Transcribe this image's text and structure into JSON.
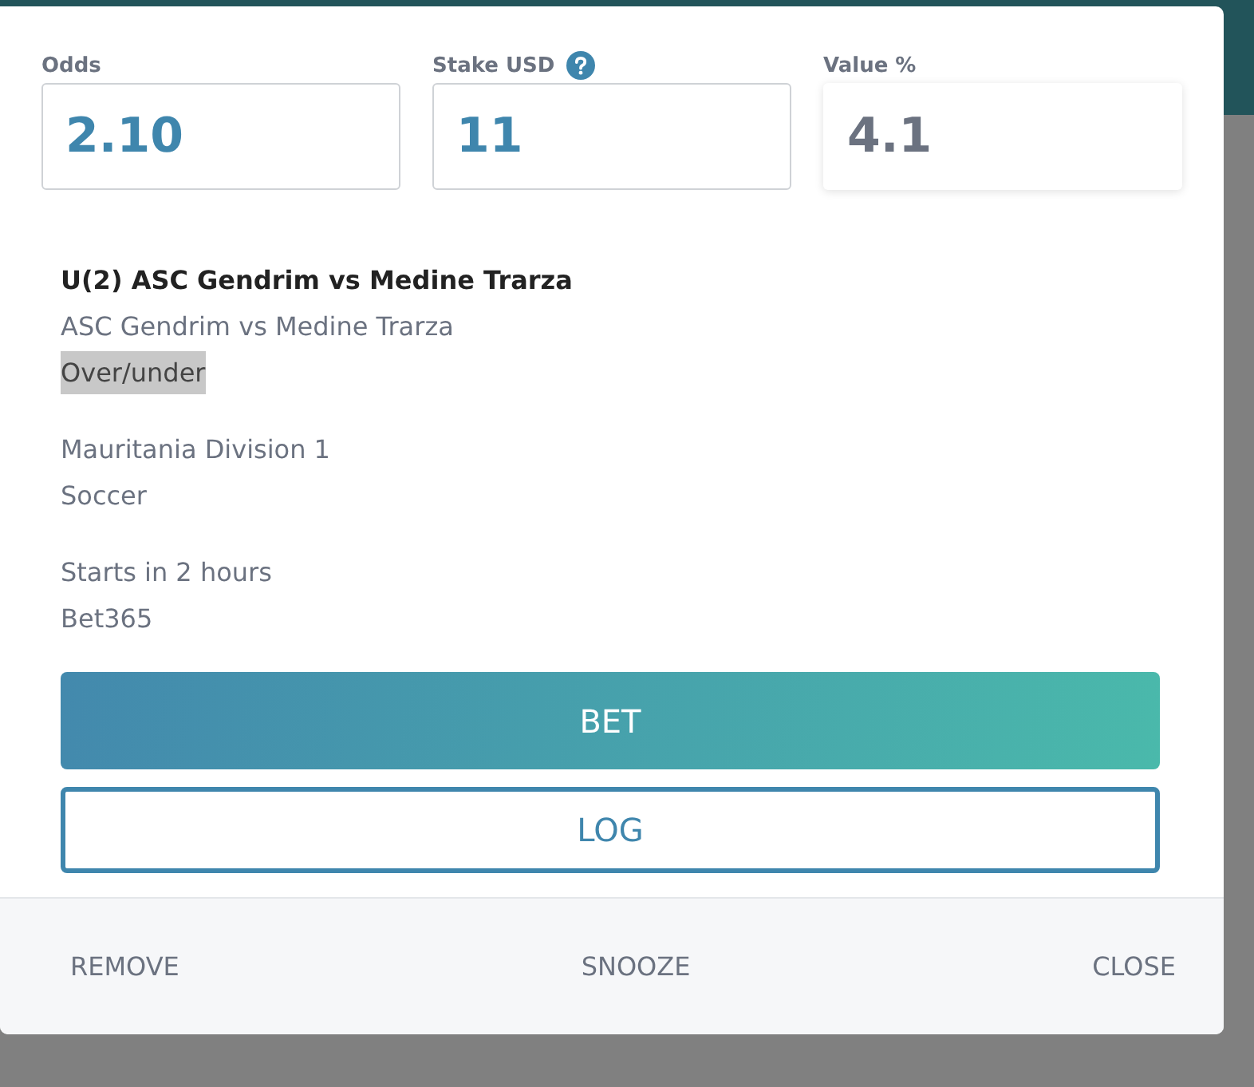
{
  "fields": [
    {
      "label": "Odds",
      "value": "2.10",
      "help": false,
      "readonly": false
    },
    {
      "label": "Stake USD",
      "value": "11",
      "help": true,
      "readonly": false
    },
    {
      "label": "Value %",
      "value": "4.1",
      "help": false,
      "readonly": true
    }
  ],
  "title": "U(2) ASC Gendrim vs Medine Trarza",
  "detail_groups": [
    [
      {
        "text": "ASC Gendrim vs Medine Trarza",
        "highlighted": false
      },
      {
        "text": "Over/under",
        "highlighted": true
      }
    ],
    [
      {
        "text": "Mauritania Division 1",
        "highlighted": false
      },
      {
        "text": "Soccer",
        "highlighted": false
      }
    ],
    [
      {
        "text": "Starts in 2 hours",
        "highlighted": false
      },
      {
        "text": "Bet365",
        "highlighted": false
      }
    ]
  ],
  "bet_button": "BET",
  "log_button": "LOG",
  "footer_buttons": [
    "REMOVE",
    "SNOOZE",
    "CLOSE"
  ]
}
